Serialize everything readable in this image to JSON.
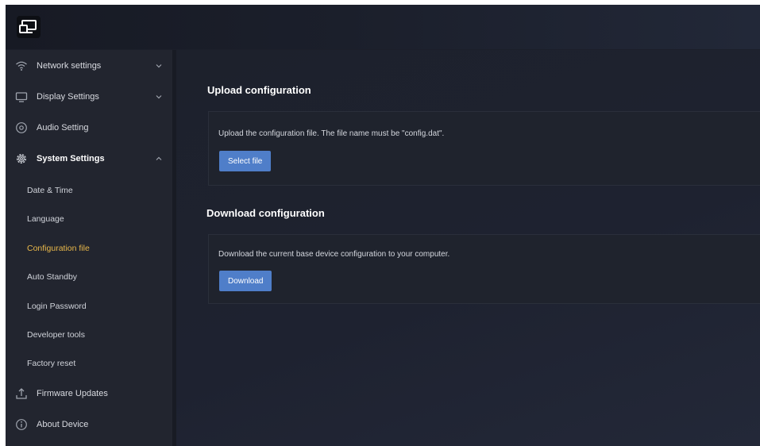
{
  "sidebar": {
    "items": [
      {
        "label": "Network settings",
        "icon": "wifi-icon",
        "chevron": "down"
      },
      {
        "label": "Display Settings",
        "icon": "monitor-icon",
        "chevron": "down"
      },
      {
        "label": "Audio Setting",
        "icon": "audio-icon"
      },
      {
        "label": "System Settings",
        "icon": "gear-icon",
        "chevron": "up"
      }
    ],
    "subitems": [
      {
        "label": "Date & Time"
      },
      {
        "label": "Language"
      },
      {
        "label": "Configuration file",
        "active": true
      },
      {
        "label": "Auto Standby"
      },
      {
        "label": "Login Password"
      },
      {
        "label": "Developer tools"
      },
      {
        "label": "Factory reset"
      }
    ],
    "bottom_items": [
      {
        "label": "Firmware Updates",
        "icon": "upload-icon"
      },
      {
        "label": "About Device",
        "icon": "info-icon"
      }
    ]
  },
  "upload": {
    "title": "Upload configuration",
    "description": "Upload the configuration file. The file name must be \"config.dat\".",
    "button": "Select file"
  },
  "download": {
    "title": "Download configuration",
    "description": "Download the current base device configuration to your computer.",
    "button": "Download"
  },
  "colors": {
    "accent": "#e9b84a",
    "button": "#4f7ec9",
    "background": "#1c1f2a"
  }
}
